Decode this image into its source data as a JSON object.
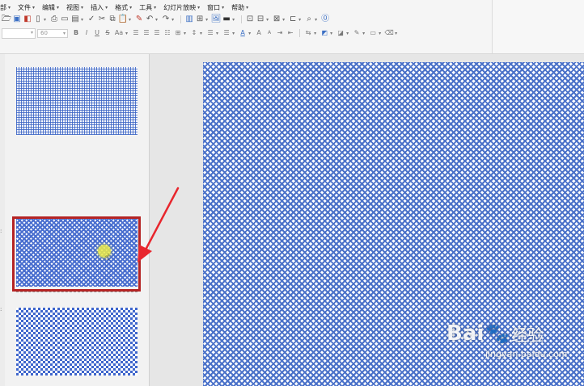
{
  "menu": {
    "items": [
      {
        "label": "部"
      },
      {
        "label": "文件"
      },
      {
        "label": "编辑"
      },
      {
        "label": "视图"
      },
      {
        "label": "插入"
      },
      {
        "label": "格式"
      },
      {
        "label": "工具"
      },
      {
        "label": "幻灯片放映"
      },
      {
        "label": "窗口"
      },
      {
        "label": "帮助"
      }
    ]
  },
  "format_toolbar": {
    "font_size_value": "60",
    "bold_glyph": "B",
    "italic_glyph": "I",
    "underline_glyph": "U",
    "strike_glyph": "S",
    "case_glyph": "Aa",
    "font_color_glyph": "A",
    "grow_glyph": "A",
    "shrink_glyph": "A"
  },
  "icons": {
    "row1": [
      "open-icon",
      "save-icon",
      "print-icon",
      "export-pdf-icon",
      "print-preview-icon",
      "find-icon",
      "spellcheck-icon",
      "cut-icon",
      "copy-icon",
      "paste-icon",
      "format-painter-icon",
      "undo-icon",
      "redo-icon",
      "chart-icon",
      "table-icon",
      "image-icon",
      "shape-icon",
      "text-box-icon",
      "field-icon",
      "navigator-icon",
      "zoom-icon",
      "help-icon"
    ]
  },
  "colors": {
    "accent_blue": "#3b6fc4",
    "selection_border": "#b52424",
    "annotation_arrow": "#e8262d"
  },
  "watermark": {
    "brand_left": "Bai",
    "brand_right": "经验",
    "url": "jingyan.baidu.com"
  }
}
